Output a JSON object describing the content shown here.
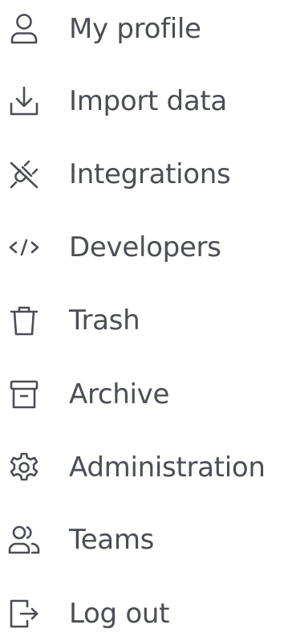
{
  "menu": {
    "items": [
      {
        "icon": "user-icon",
        "label": "My profile"
      },
      {
        "icon": "download-icon",
        "label": "Import data"
      },
      {
        "icon": "plug-off-icon",
        "label": "Integrations"
      },
      {
        "icon": "code-icon",
        "label": "Developers"
      },
      {
        "icon": "trash-icon",
        "label": "Trash"
      },
      {
        "icon": "archive-icon",
        "label": "Archive"
      },
      {
        "icon": "gear-icon",
        "label": "Administration"
      },
      {
        "icon": "users-icon",
        "label": "Teams"
      },
      {
        "icon": "logout-icon",
        "label": "Log out"
      }
    ]
  },
  "colors": {
    "text": "#4b4e55",
    "icon": "#4b4e55",
    "background": "#ffffff"
  }
}
